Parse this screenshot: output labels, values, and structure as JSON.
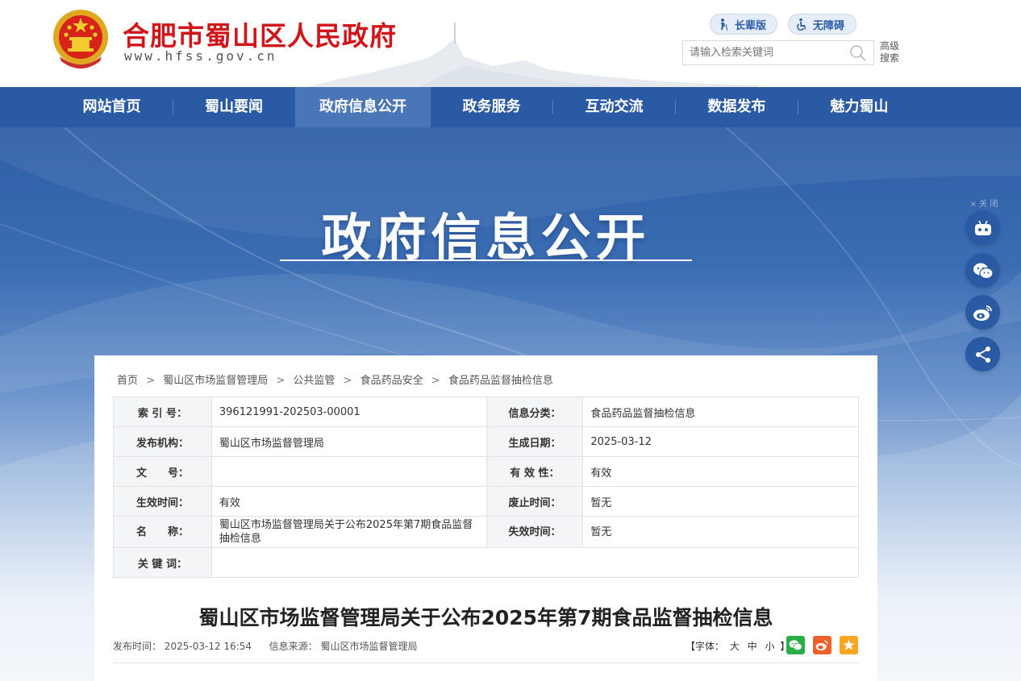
{
  "header": {
    "site_title": "合肥市蜀山区人民政府",
    "site_url": "www.hfss.gov.cn",
    "elder_mode": "长辈版",
    "accessibility": "无障碍",
    "search_placeholder": "请输入检索关键词",
    "advanced_search_line1": "高级",
    "advanced_search_line2": "搜索"
  },
  "nav": {
    "items": [
      {
        "label": "网站首页"
      },
      {
        "label": "蜀山要闻"
      },
      {
        "label": "政府信息公开"
      },
      {
        "label": "政务服务"
      },
      {
        "label": "互动交流"
      },
      {
        "label": "数据发布"
      },
      {
        "label": "魅力蜀山"
      }
    ],
    "active_index": 2
  },
  "banner": {
    "title": "政府信息公开"
  },
  "side": {
    "close_label": "× 关 闭",
    "buttons": [
      "robot-icon",
      "wechat-icon",
      "weibo-icon",
      "share-icon"
    ]
  },
  "breadcrumb": [
    "首页",
    "蜀山区市场监督管理局",
    "公共监管",
    "食品药品安全",
    "食品药品监督抽检信息"
  ],
  "breadcrumb_sep": ">",
  "meta": {
    "index_label": "索 引 号：",
    "index_value": "396121991-202503-00001",
    "category_label": "信息分类：",
    "category_value": "食品药品监督抽检信息",
    "publisher_label": "发布机构：",
    "publisher_value": "蜀山区市场监督管理局",
    "created_label": "生成日期：",
    "created_value": "2025-03-12",
    "docno_label": "文　　号：",
    "docno_value": "",
    "validity_label": "有 效 性：",
    "validity_value": "有效",
    "effective_label": "生效时间：",
    "effective_value": "有效",
    "repeal_label": "废止时间：",
    "repeal_value": "暂无",
    "name_label": "名　　称：",
    "name_value": "蜀山区市场监督管理局关于公布2025年第7期食品监督抽检信息",
    "expire_label": "失效时间：",
    "expire_value": "暂无",
    "keywords_label": "关 键 词：",
    "keywords_value": ""
  },
  "article": {
    "title": "蜀山区市场监督管理局关于公布2025年第7期食品监督抽检信息",
    "pub_time_label": "发布时间：",
    "pub_time": "2025-03-12 16:54",
    "source_label": "信息来源：",
    "source": "蜀山区市场监督管理局",
    "font_prefix": "【字体：",
    "font_large": "大",
    "font_medium": "中",
    "font_small": "小",
    "font_suffix": "】"
  },
  "colors": {
    "primary_blue": "#2a5aa3",
    "title_red": "#d0161b",
    "wechat_green": "#2aae4a",
    "weibo_orange": "#f0602a",
    "favorite_orange": "#f6a623"
  }
}
